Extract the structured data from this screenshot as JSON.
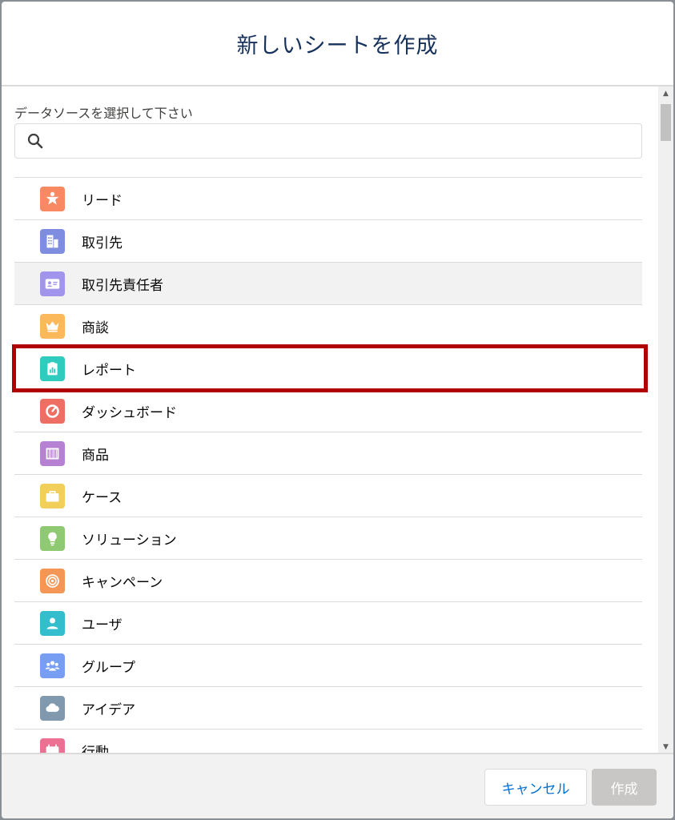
{
  "dialog": {
    "title": "新しいシートを作成"
  },
  "datasource": {
    "label": "データソースを選択して下さい",
    "search_value": "",
    "search_placeholder": ""
  },
  "items": [
    {
      "label": "リード",
      "icon": "lead-icon",
      "color": "#f88962"
    },
    {
      "label": "取引先",
      "icon": "account-icon",
      "color": "#7f8de1"
    },
    {
      "label": "取引先責任者",
      "icon": "contact-icon",
      "color": "#a094ed",
      "selected": true
    },
    {
      "label": "商談",
      "icon": "opportunity-icon",
      "color": "#fcb95b"
    },
    {
      "label": "レポート",
      "icon": "report-icon",
      "color": "#2ecbbe"
    },
    {
      "label": "ダッシュボード",
      "icon": "dashboard-icon",
      "color": "#ef6e64"
    },
    {
      "label": "商品",
      "icon": "product-icon",
      "color": "#b781d3"
    },
    {
      "label": "ケース",
      "icon": "case-icon",
      "color": "#f2cf5b"
    },
    {
      "label": "ソリューション",
      "icon": "solution-icon",
      "color": "#8fc972"
    },
    {
      "label": "キャンペーン",
      "icon": "campaign-icon",
      "color": "#f49756"
    },
    {
      "label": "ユーザ",
      "icon": "user-icon",
      "color": "#34becd"
    },
    {
      "label": "グループ",
      "icon": "group-icon",
      "color": "#779ef2"
    },
    {
      "label": "アイデア",
      "icon": "idea-icon",
      "color": "#8199af"
    },
    {
      "label": "行動",
      "icon": "event-icon",
      "color": "#eb7092"
    }
  ],
  "footer": {
    "cancel_label": "キャンセル",
    "create_label": "作成"
  },
  "colors": {
    "highlight": "#b00000",
    "link": "#0070d2",
    "title": "#16325c"
  }
}
